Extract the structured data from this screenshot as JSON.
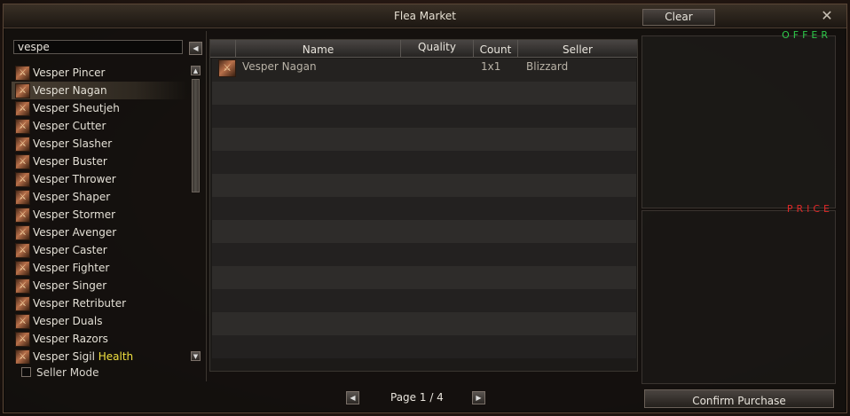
{
  "window": {
    "title": "Flea Market",
    "clear_label": "Clear",
    "close_glyph": "✕"
  },
  "search": {
    "value": "vespe"
  },
  "item_list": [
    {
      "icon": "dagger-icon",
      "label": "Vesper Pincer",
      "extra": ""
    },
    {
      "icon": "dagger-icon",
      "label": "Vesper Nagan",
      "extra": "",
      "selected": true
    },
    {
      "icon": "sword-icon",
      "label": "Vesper Sheutjeh",
      "extra": ""
    },
    {
      "icon": "sword-icon",
      "label": "Vesper Cutter",
      "extra": ""
    },
    {
      "icon": "sword-icon",
      "label": "Vesper Slasher",
      "extra": ""
    },
    {
      "icon": "sword-icon",
      "label": "Vesper Buster",
      "extra": ""
    },
    {
      "icon": "bow-icon",
      "label": "Vesper Thrower",
      "extra": ""
    },
    {
      "icon": "dagger-icon",
      "label": "Vesper Shaper",
      "extra": ""
    },
    {
      "icon": "dagger-icon",
      "label": "Vesper Stormer",
      "extra": ""
    },
    {
      "icon": "staff-icon",
      "label": "Vesper Avenger",
      "extra": ""
    },
    {
      "icon": "staff-icon",
      "label": "Vesper Caster",
      "extra": ""
    },
    {
      "icon": "fist-icon",
      "label": "Vesper Fighter",
      "extra": ""
    },
    {
      "icon": "staff-icon",
      "label": "Vesper Singer",
      "extra": ""
    },
    {
      "icon": "staff-icon",
      "label": "Vesper Retributer",
      "extra": ""
    },
    {
      "icon": "dual-swords-icon",
      "label": "Vesper Duals",
      "extra": ""
    },
    {
      "icon": "razor-icon",
      "label": "Vesper Razors",
      "extra": ""
    },
    {
      "icon": "sigil-icon",
      "label": "Vesper Sigil",
      "extra": "Health"
    }
  ],
  "seller_mode": {
    "label": "Seller Mode",
    "checked": false
  },
  "table": {
    "headers": {
      "name": "Name",
      "quality": "Quality",
      "count": "Count",
      "seller": "Seller"
    },
    "rows": [
      {
        "icon": "dagger-icon",
        "name": "Vesper Nagan",
        "quality": "",
        "count": "1x1",
        "seller": "Blizzard"
      }
    ]
  },
  "side_panels": {
    "offer_label": "OFFER",
    "price_label": "PRICE"
  },
  "pager": {
    "text": "Page 1 / 4",
    "prev_glyph": "◀",
    "next_glyph": "▶"
  },
  "confirm_label": "Confirm Purchase",
  "colors": {
    "offer": "#2ec84a",
    "price": "#e02828",
    "highlight": "#f0e040"
  }
}
